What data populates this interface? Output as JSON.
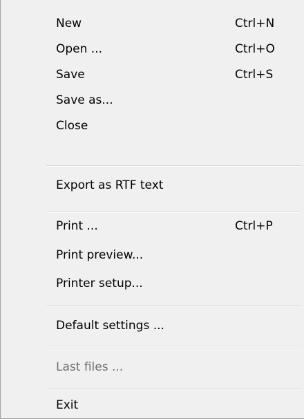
{
  "menu": {
    "items": [
      {
        "label": "New",
        "shortcut": "Ctrl+N"
      },
      {
        "label": "Open ...",
        "shortcut": "Ctrl+O"
      },
      {
        "label": "Save",
        "shortcut": "Ctrl+S"
      },
      {
        "label": "Save as...",
        "shortcut": ""
      },
      {
        "label": "Close",
        "shortcut": ""
      },
      {
        "label": "Export as RTF text",
        "shortcut": ""
      },
      {
        "label": "Print ...",
        "shortcut": "Ctrl+P"
      },
      {
        "label": "Print preview...",
        "shortcut": ""
      },
      {
        "label": "Printer setup...",
        "shortcut": ""
      },
      {
        "label": "Default settings ...",
        "shortcut": ""
      },
      {
        "label": "Last files ...",
        "shortcut": "",
        "disabled": true
      },
      {
        "label": "Exit",
        "shortcut": ""
      }
    ]
  }
}
